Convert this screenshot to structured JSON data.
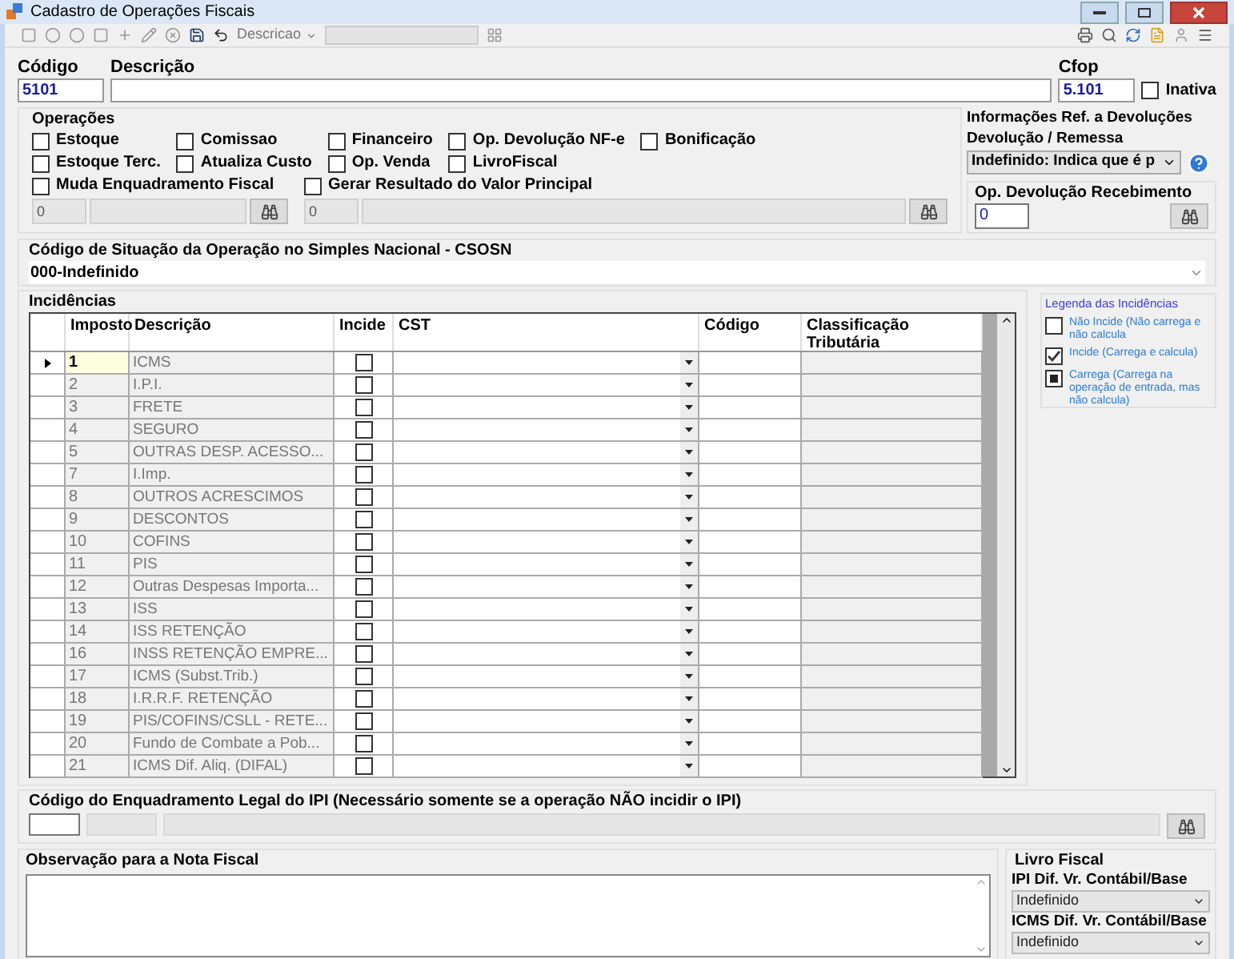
{
  "window": {
    "title": "Cadastro de Operações Fiscais"
  },
  "toolbar": {
    "search_dropdown": "Descricao"
  },
  "header": {
    "codigo": {
      "label": "Código",
      "value": "5101"
    },
    "descricao": {
      "label": "Descrição"
    },
    "cfop": {
      "label": "Cfop",
      "value": "5.101"
    },
    "inativa": {
      "label": "Inativa",
      "checked": false
    }
  },
  "operacoes": {
    "title": "Operações",
    "options": [
      {
        "label": "Estoque",
        "checked": false
      },
      {
        "label": "Comissao",
        "checked": false
      },
      {
        "label": "Financeiro",
        "checked": false
      },
      {
        "label": "Op.  Devolução NF-e",
        "checked": false
      },
      {
        "label": "Bonificação",
        "checked": false
      },
      {
        "label": "Estoque Terc.",
        "checked": false
      },
      {
        "label": "Atualiza Custo",
        "checked": false
      },
      {
        "label": "Op. Venda",
        "checked": false
      },
      {
        "label": "LivroFiscal",
        "checked": false
      }
    ],
    "muda": {
      "label": "Muda Enquadramento Fiscal",
      "checked": false,
      "code": "0"
    },
    "gerar": {
      "label": "Gerar Resultado do Valor Principal",
      "checked": false,
      "code": "0"
    }
  },
  "devolucoes": {
    "title": "Informações Ref. a Devoluções",
    "subtitle": "Devolução / Remessa",
    "value": "Indefinido: Indica que é p",
    "recebimento": {
      "label": "Op. Devolução Recebimento",
      "value": "0"
    }
  },
  "csosn": {
    "label": "Código de Situação da Operação no Simples Nacional - CSOSN",
    "value": "000-Indefinido"
  },
  "incidencias": {
    "title": "Incidências",
    "columns": [
      "Imposto",
      "Descrição",
      "Incide",
      "CST",
      "Código",
      "Classificação Tributária"
    ],
    "rows": [
      {
        "imposto": "1",
        "descricao": "ICMS",
        "incide": false,
        "selected": true
      },
      {
        "imposto": "2",
        "descricao": "I.P.I.",
        "incide": false,
        "selected": false
      },
      {
        "imposto": "3",
        "descricao": "FRETE",
        "incide": false,
        "selected": false
      },
      {
        "imposto": "4",
        "descricao": "SEGURO",
        "incide": false,
        "selected": false
      },
      {
        "imposto": "5",
        "descricao": "OUTRAS DESP. ACESSO...",
        "incide": false,
        "selected": false
      },
      {
        "imposto": "7",
        "descricao": "I.Imp.",
        "incide": false,
        "selected": false
      },
      {
        "imposto": "8",
        "descricao": "OUTROS ACRESCIMOS",
        "incide": false,
        "selected": false
      },
      {
        "imposto": "9",
        "descricao": "DESCONTOS",
        "incide": false,
        "selected": false
      },
      {
        "imposto": "10",
        "descricao": "COFINS",
        "incide": false,
        "selected": false
      },
      {
        "imposto": "11",
        "descricao": "PIS",
        "incide": false,
        "selected": false
      },
      {
        "imposto": "12",
        "descricao": "Outras Despesas Importa...",
        "incide": false,
        "selected": false
      },
      {
        "imposto": "13",
        "descricao": "ISS",
        "incide": false,
        "selected": false
      },
      {
        "imposto": "14",
        "descricao": "ISS RETENÇÃO",
        "incide": false,
        "selected": false
      },
      {
        "imposto": "16",
        "descricao": "INSS RETENÇÃO EMPRE...",
        "incide": false,
        "selected": false
      },
      {
        "imposto": "17",
        "descricao": "ICMS (Subst.Trib.)",
        "incide": false,
        "selected": false
      },
      {
        "imposto": "18",
        "descricao": "I.R.R.F. RETENÇÃO",
        "incide": false,
        "selected": false
      },
      {
        "imposto": "19",
        "descricao": "PIS/COFINS/CSLL - RETE...",
        "incide": false,
        "selected": false
      },
      {
        "imposto": "20",
        "descricao": "Fundo de Combate a Pob...",
        "incide": false,
        "selected": false
      },
      {
        "imposto": "21",
        "descricao": "ICMS Dif. Aliq. (DIFAL)",
        "incide": false,
        "selected": false
      }
    ]
  },
  "legenda": {
    "title": "Legenda das Incidências",
    "items": [
      {
        "kind": "empty",
        "label": "Não Incide (Não carrega e não calcula"
      },
      {
        "kind": "checked",
        "label": "Incide (Carrega e calcula)"
      },
      {
        "kind": "filled",
        "label": "Carrega (Carrega na operação de entrada, mas não calcula)"
      }
    ]
  },
  "ipi": {
    "label": "Código do Enquadramento Legal do IPI (Necessário somente se a operação NÃO incidir o IPI)"
  },
  "observacao": {
    "label": "Observação para a Nota Fiscal"
  },
  "livro_fiscal": {
    "title": "Livro Fiscal",
    "fields": [
      {
        "label": "IPI Dif. Vr. Contábil/Base",
        "value": "Indefinido"
      },
      {
        "label": "ICMS Dif. Vr. Contábil/Base",
        "value": "Indefinido"
      }
    ]
  }
}
